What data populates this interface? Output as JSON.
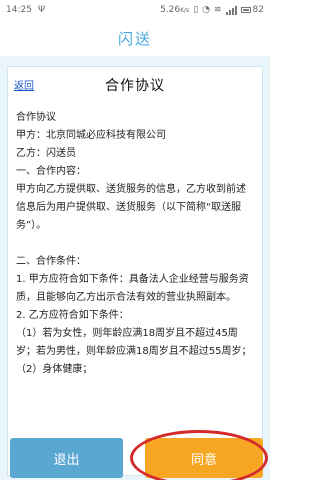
{
  "status_bar": {
    "time": "14:25",
    "notification_icon": "usb-icon",
    "network_speed": "5.26",
    "network_unit": "K/s",
    "battery": "82"
  },
  "title_bar": {
    "title": "闪送"
  },
  "document": {
    "back_label": "返回",
    "title": "合作协议",
    "paragraphs": [
      "合作协议",
      "甲方：北京同城必应科技有限公司",
      "乙方：闪送员",
      "一、合作内容：",
      "甲方向乙方提供取、送货服务的信息，乙方收到前述信息后为用户提供取、送货服务（以下简称“取送服务”）。",
      "",
      "二、合作条件：",
      "1. 甲方应符合如下条件：具备法人企业经营与服务资质，且能够向乙方出示合法有效的营业执照副本。",
      "2. 乙方应符合如下条件：",
      "（1）若为女性，则年龄应满18周岁且不超过45周岁；若为男性，则年龄应满18周岁且不超过55周岁；",
      "（2）身体健康；"
    ]
  },
  "buttons": {
    "exit_label": "退出",
    "agree_label": "同意"
  },
  "colors": {
    "accent": "#4aa8e0",
    "exit_button": "#5aa7d2",
    "agree_button": "#f6a623",
    "highlight": "#d42a2a",
    "background": "#e9f4fb"
  }
}
